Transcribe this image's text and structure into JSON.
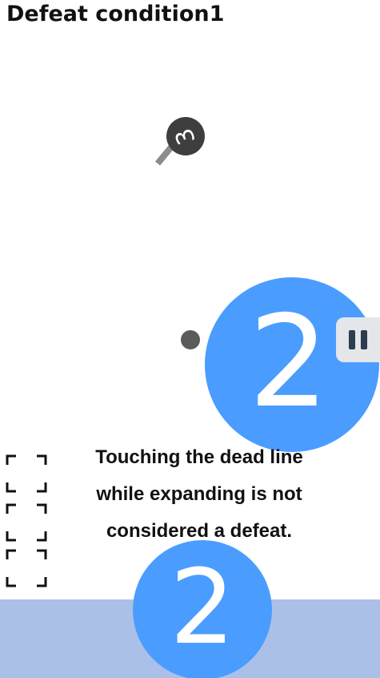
{
  "title": "Defeat condition1",
  "hint": {
    "lines": [
      "Touching the dead line",
      "while expanding is not",
      "considered a defeat."
    ]
  },
  "bubbles": {
    "expanding": {
      "label": "2"
    },
    "bottom": {
      "label": "2"
    }
  },
  "token": {
    "label": "3",
    "icon": "magnifier-3-icon"
  },
  "pause_button": {
    "icon": "pause-icon"
  },
  "deadline_markers": {
    "icon": "dead-line-corner-brackets",
    "count": 3
  },
  "colors": {
    "bubble": "#4a9dff",
    "bottom_band": "#abc0e8",
    "dot": "#5b5b5b",
    "token_body": "#3e3e3e",
    "token_handle": "#8c8c8c",
    "pause_bg": "#e4e6ea",
    "pause_bars": "#2e3d4e",
    "bracket": "#111111"
  }
}
